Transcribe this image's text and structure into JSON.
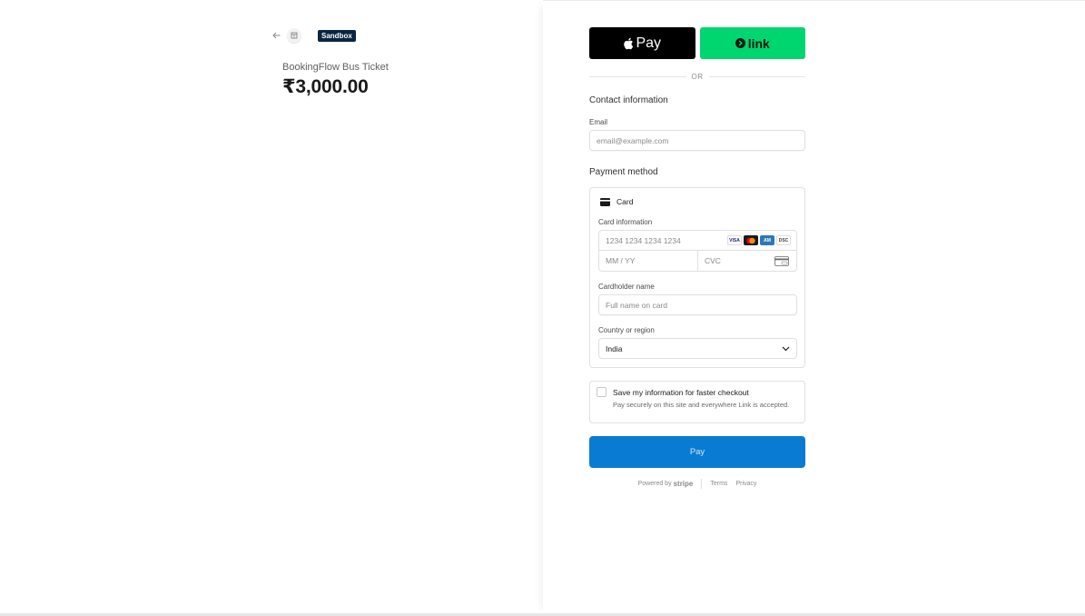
{
  "header": {
    "sandbox_badge": "Sandbox"
  },
  "product": {
    "name": "BookingFlow Bus Ticket",
    "price": "₹3,000.00"
  },
  "wallets": {
    "apple_pay_label": "Pay",
    "link_label": "link"
  },
  "divider": {
    "or_text": "OR"
  },
  "contact": {
    "title": "Contact information",
    "email_label": "Email",
    "email_placeholder": "email@example.com"
  },
  "payment": {
    "title": "Payment method",
    "card_tab_label": "Card",
    "card_info_label": "Card information",
    "card_number_placeholder": "1234 1234 1234 1234",
    "expiry_placeholder": "MM / YY",
    "cvc_placeholder": "CVC",
    "card_brands": [
      "visa-icon",
      "mastercard-icon",
      "amex-icon",
      "discover-icon"
    ],
    "cardholder_label": "Cardholder name",
    "cardholder_placeholder": "Full name on card",
    "country_label": "Country or region",
    "country_value": "India"
  },
  "save_info": {
    "title": "Save my information for faster checkout",
    "description": "Pay securely on this site and everywhere Link is accepted."
  },
  "pay_button": {
    "label": "Pay"
  },
  "footer": {
    "powered_by": "Powered by",
    "stripe": "stripe",
    "terms": "Terms",
    "privacy": "Privacy"
  },
  "colors": {
    "pay_button": "#0a7bd2",
    "link_green": "#00d66f",
    "sandbox_bg": "#0b2540"
  }
}
